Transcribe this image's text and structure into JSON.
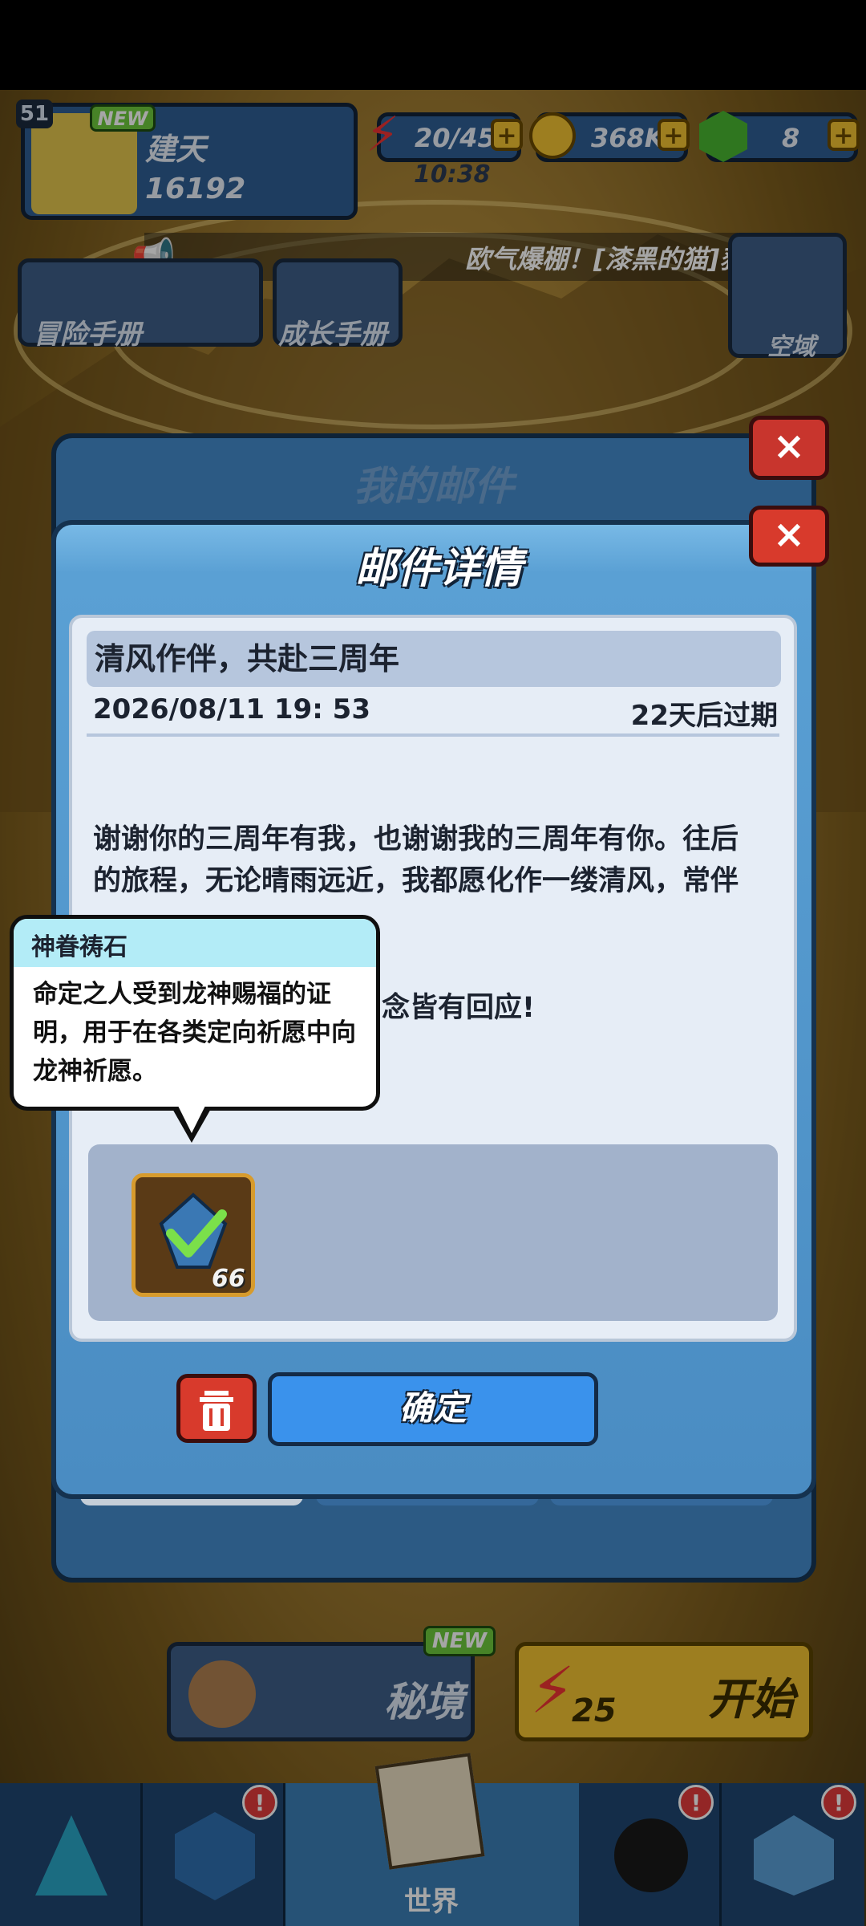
{
  "hud": {
    "level": "51",
    "new_badge": "NEW",
    "player_name": "建天",
    "power": "16192",
    "energy": "20/45",
    "energy_timer": "10:38",
    "coins": "368K",
    "gems": "8",
    "plus": "+"
  },
  "broadcast": "欧气爆棚！[漆黑的猫]获",
  "menus": {
    "adventure_manual": "冒险手册",
    "growth_manual": "成长手册",
    "void_domain": "空域"
  },
  "back_dialog": {
    "title": "我的邮件",
    "close": "×"
  },
  "mail": {
    "title": "邮件详情",
    "close": "×",
    "subject": "清风作伴，共赴三周年",
    "date": "2026/08/11 19: 53",
    "expire": "22天后过期",
    "body_line1": "谢谢你的三周年有我，也谢谢我的三周年有你。往后",
    "body_line2": "的旅程，无论晴雨远近，我都愿化作一缕清风，常伴",
    "body_line4": "念皆有回应!",
    "attachment": {
      "item_name": "神眷祷石",
      "count": "66"
    },
    "confirm_label": "确定"
  },
  "tooltip": {
    "title": "神眷祷石",
    "description": "命定之人受到龙神赐福的证明，用于在各类定向祈愿中向龙神祈愿。"
  },
  "bottom": {
    "secret_realm": "秘境",
    "secret_new": "NEW",
    "start": "开始",
    "start_cost": "25",
    "nav_world": "世界",
    "badge": "!"
  },
  "colors": {
    "dialog_blue": "#5b9fd2",
    "confirm_blue": "#3a92ec",
    "close_red": "#d83a2c",
    "tooltip_header": "#b3ecf7",
    "start_yellow": "#f2c232"
  }
}
